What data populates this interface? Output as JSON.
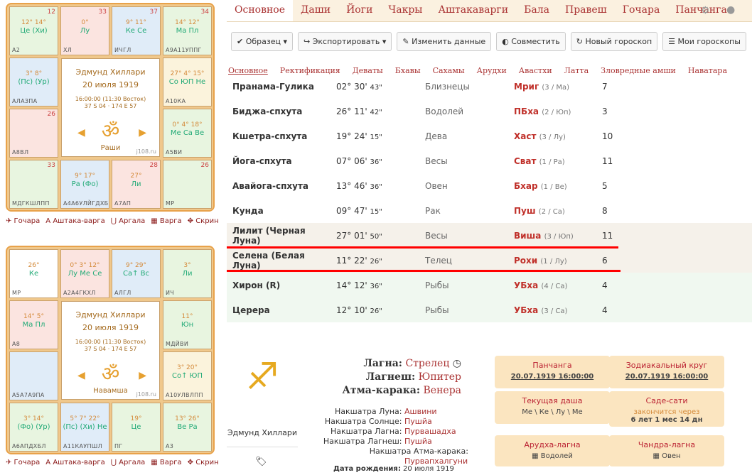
{
  "chart1": {
    "cells": [
      {
        "num": "12",
        "deg": "12° 14°",
        "planets": "Це (Хи)",
        "label": "A2",
        "bg": "g",
        "pos": [
          0,
          0
        ]
      },
      {
        "num": "33",
        "deg": "0°",
        "planets": "Лу",
        "label": "ХЛ",
        "bg": "r",
        "pos": [
          1,
          0
        ]
      },
      {
        "num": "37",
        "deg": "9° 11°",
        "planets": "Ке Се",
        "label": "ИЧГЛ",
        "bg": "b",
        "pos": [
          2,
          0
        ]
      },
      {
        "num": "34",
        "deg": "14° 12°",
        "planets": "Ма Пл",
        "label": "А9А11УППГ",
        "bg": "g",
        "pos": [
          3,
          0
        ]
      },
      {
        "num": "",
        "deg": "3° 8°",
        "planets": "(Пс) (Ур)",
        "label": "АЛАЗПА",
        "bg": "b",
        "pos": [
          0,
          1
        ]
      },
      {
        "num": "26",
        "deg": "",
        "planets": "",
        "label": "А8ВЛ",
        "bg": "r",
        "pos": [
          0,
          2
        ]
      },
      {
        "num": "",
        "deg": "27° 4° 15°",
        "planets": "Со ЮП Не",
        "label": "А10КА",
        "bg": "y",
        "pos": [
          3,
          1
        ]
      },
      {
        "num": "",
        "deg": "0° 4° 18°",
        "planets": "Ме Са Ве",
        "label": "А5ВИ",
        "bg": "g",
        "pos": [
          3,
          2
        ]
      },
      {
        "num": "33",
        "deg": "",
        "planets": "",
        "label": "МДГКШЛПП",
        "bg": "g",
        "pos": [
          0,
          3
        ]
      },
      {
        "num": "",
        "deg": "9° 17°",
        "planets": "Ра (Фо)",
        "label": "А4А6УЛЙГДХБ",
        "bg": "b",
        "pos": [
          1,
          3
        ]
      },
      {
        "num": "28",
        "deg": "27°",
        "planets": "Ли",
        "label": "А7АП",
        "bg": "r",
        "pos": [
          2,
          3
        ]
      },
      {
        "num": "26",
        "deg": "",
        "planets": "",
        "label": "МР",
        "bg": "g",
        "pos": [
          3,
          3
        ]
      }
    ],
    "name": "Эдмунд Хиллари",
    "date": "20 июля 1919",
    "time": "16:00:00 (11:30 Восток)",
    "coords": "37 S 04 · 174 E 57",
    "type": "Раши",
    "site": "j108.ru"
  },
  "chart2": {
    "cells": [
      {
        "num": "",
        "deg": "26°",
        "planets": "Ке",
        "label": "МР",
        "bg": "w",
        "pos": [
          0,
          0
        ]
      },
      {
        "num": "",
        "deg": "0° 3° 12°",
        "planets": "Лу Ме Се",
        "label": "А2А4ГКХЛ",
        "bg": "r",
        "pos": [
          1,
          0
        ]
      },
      {
        "num": "",
        "deg": "9° 29°",
        "planets": "Са↑ Вс",
        "label": "АЛГЛ",
        "bg": "b",
        "pos": [
          2,
          0
        ]
      },
      {
        "num": "",
        "deg": "3°",
        "planets": "Ли",
        "label": "ИЧ",
        "bg": "g",
        "pos": [
          3,
          0
        ]
      },
      {
        "num": "",
        "deg": "14° 5°",
        "planets": "Ма Пл",
        "label": "А8",
        "bg": "r",
        "pos": [
          0,
          1
        ]
      },
      {
        "num": "",
        "deg": "",
        "planets": "",
        "label": "А5А7А9ПА",
        "bg": "b",
        "pos": [
          0,
          2
        ]
      },
      {
        "num": "",
        "deg": "11°",
        "planets": "Юн",
        "label": "МДЙВИ",
        "bg": "g",
        "pos": [
          3,
          1
        ]
      },
      {
        "num": "",
        "deg": "3° 20°",
        "planets": "Со↑ ЮП",
        "label": "А10УЛВЛПП",
        "bg": "y",
        "pos": [
          3,
          2
        ]
      },
      {
        "num": "",
        "deg": "3° 14°",
        "planets": "(Фо) (Ур)",
        "label": "А6АПДХБЛ",
        "bg": "g",
        "pos": [
          0,
          3
        ]
      },
      {
        "num": "",
        "deg": "5° 7° 22°",
        "planets": "(Пс) (Хи) Не",
        "label": "А11КАУПШЛ",
        "bg": "b",
        "pos": [
          1,
          3
        ]
      },
      {
        "num": "",
        "deg": "19°",
        "planets": "Це",
        "label": "ПГ",
        "bg": "g",
        "pos": [
          2,
          3
        ]
      },
      {
        "num": "",
        "deg": "13° 26°",
        "planets": "Ве Ра",
        "label": "А3",
        "bg": "g",
        "pos": [
          3,
          3
        ]
      }
    ],
    "name": "Эдмунд Хиллари",
    "date": "20 июля 1919",
    "time": "16:00:00 (11:30 Восток)",
    "coords": "37 S 04 · 174 E 57",
    "type": "Навамша",
    "site": "j108.ru"
  },
  "chart_links": [
    "Гочара",
    "Аштака-варга",
    "Аргала",
    "Варга",
    "Скрин"
  ],
  "tabs": [
    "Основное",
    "Даши",
    "Йоги",
    "Чакры",
    "Аштакаварги",
    "Бала",
    "Правеш",
    "Гочара",
    "Панчанга"
  ],
  "buttons": [
    "Образец",
    "Экспортировать",
    "Изменить данные",
    "Совместить",
    "Новый гороскоп",
    "Мои гороскопы"
  ],
  "subtabs": [
    "Основное",
    "Ректификация",
    "Деваты",
    "Бхавы",
    "Сахамы",
    "Арудхи",
    "Авастхи",
    "Латта",
    "Зловредные амши",
    "Наватара"
  ],
  "rows": [
    {
      "name": "Пранама-Гулика",
      "deg": "02° 30'",
      "sec": "43\"",
      "sign": "Близнецы",
      "nak": "Мриг",
      "nsub": "(3 / Ма)",
      "house": "7",
      "cls": ""
    },
    {
      "name": "Биджа-спхута",
      "deg": "26° 11'",
      "sec": "42\"",
      "sign": "Водолей",
      "nak": "ПБха",
      "nsub": "(2 / Юп)",
      "house": "3",
      "cls": ""
    },
    {
      "name": "Кшетра-спхута",
      "deg": "19° 24'",
      "sec": "15\"",
      "sign": "Дева",
      "nak": "Хаст",
      "nsub": "(3 / Лу)",
      "house": "10",
      "cls": ""
    },
    {
      "name": "Йога-спхута",
      "deg": "07° 06'",
      "sec": "36\"",
      "sign": "Весы",
      "nak": "Сват",
      "nsub": "(1 / Ра)",
      "house": "11",
      "cls": ""
    },
    {
      "name": "Авайога-спхута",
      "deg": "13° 46'",
      "sec": "36\"",
      "sign": "Овен",
      "nak": "Бхар",
      "nsub": "(1 / Ве)",
      "house": "5",
      "cls": ""
    },
    {
      "name": "Кунда",
      "deg": "09° 47'",
      "sec": "15\"",
      "sign": "Рак",
      "nak": "Пуш",
      "nsub": "(2 / Са)",
      "house": "8",
      "cls": ""
    },
    {
      "name": "Лилит (Черная Луна)",
      "deg": "27° 01'",
      "sec": "50\"",
      "sign": "Весы",
      "nak": "Виша",
      "nsub": "(3 / Юп)",
      "house": "11",
      "cls": "hi"
    },
    {
      "name": "Селена (Белая Луна)",
      "deg": "11° 22'",
      "sec": "26\"",
      "sign": "Телец",
      "nak": "Рохи",
      "nsub": "(1 / Лу)",
      "house": "6",
      "cls": "hi"
    },
    {
      "name": "Хирон (R)",
      "deg": "14° 12'",
      "sec": "36\"",
      "sign": "Рыбы",
      "nak": "УБха",
      "nsub": "(4 / Са)",
      "house": "4",
      "cls": "gr"
    },
    {
      "name": "Церера",
      "deg": "12° 10'",
      "sec": "26\"",
      "sign": "Рыбы",
      "nak": "УБха",
      "nsub": "(3 / Са)",
      "house": "4",
      "cls": "gr"
    }
  ],
  "info": {
    "person": "Эдмунд Хиллари",
    "lagna_l": "Лагна:",
    "lagna_v": "Стрелец",
    "lagnesh_l": "Лагнеш:",
    "lagnesh_v": "Юпитер",
    "atma_l": "Атма-карака:",
    "atma_v": "Венера",
    "nak": [
      {
        "l": "Накшатра Луна:",
        "v": "Ашвини"
      },
      {
        "l": "Накшатра Солнце:",
        "v": "Пушйа"
      },
      {
        "l": "Накшатра Лагна:",
        "v": "Пурвашадха"
      },
      {
        "l": "Накшатра Лагнеш:",
        "v": "Пушйа"
      },
      {
        "l": "Накшатра Атма-карака:",
        "v": "Пурвапхалгуни"
      }
    ],
    "birth_l": "Дата рождения:",
    "birth_v": "20 июля 1919"
  },
  "cards": [
    {
      "title": "Панчанга",
      "sub": "20.07.1919 16:00:00"
    },
    {
      "title": "Зодиакальный круг",
      "sub": "20.07.1919 16:00:00"
    },
    {
      "title": "Текущая даша",
      "sub": "Ме \\ Ке \\ Лу \\ Ме"
    },
    {
      "title": "Саде-сати",
      "sub": "закончится через",
      "sub2": "6 лет 1 мес 14 дн"
    },
    {
      "title": "Арудха-лагна",
      "sub": "Водолей"
    },
    {
      "title": "Чандра-лагна",
      "sub": "Овен"
    }
  ]
}
